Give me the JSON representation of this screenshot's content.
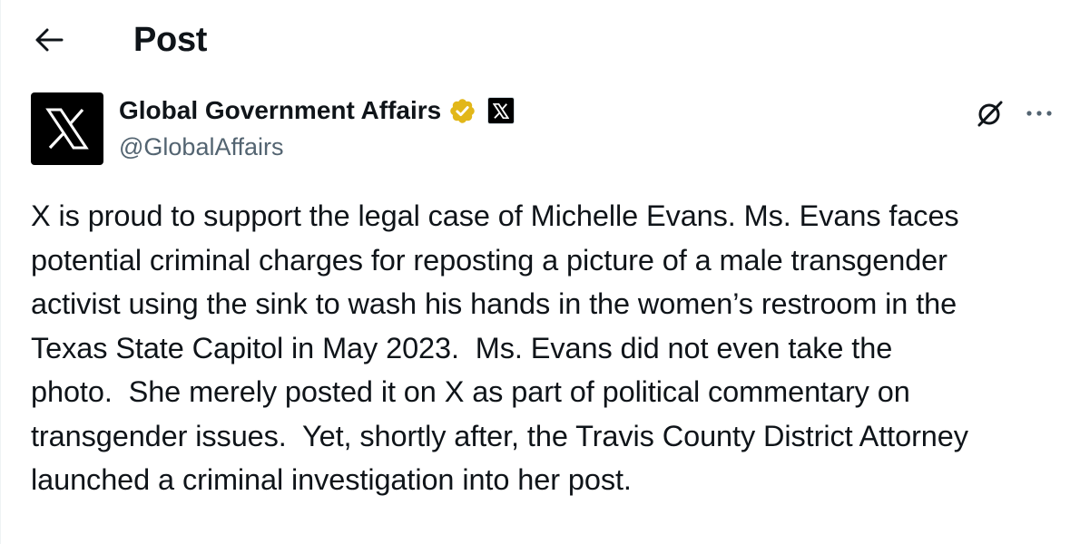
{
  "header": {
    "back_icon": "arrow-left-icon",
    "title": "Post"
  },
  "author": {
    "avatar_icon": "x-logo-icon",
    "display_name": "Global Government Affairs",
    "verified_badge_icon": "gold-verified-badge-icon",
    "verified_color": "#e2b719",
    "affiliation_icon": "x-logo-icon",
    "handle": "@GlobalAffairs"
  },
  "actions": {
    "grok_icon": "grok-icon",
    "more_icon": "more-horizontal-icon"
  },
  "post": {
    "lines": [
      "X is proud to support the legal case of Michelle Evans. Ms. Evans faces",
      "potential criminal charges for reposting a picture of a male transgender",
      "activist using the sink to wash his hands in the women’s restroom in the",
      "Texas State Capitol in May 2023.  Ms. Evans did not even take the",
      "photo.  She merely posted it on X as part of political commentary on",
      "transgender issues.  Yet, shortly after, the Travis County District Attorney",
      "launched a criminal investigation into her post."
    ]
  },
  "colors": {
    "text_primary": "#0f1419",
    "text_secondary": "#536471",
    "background": "#ffffff"
  }
}
